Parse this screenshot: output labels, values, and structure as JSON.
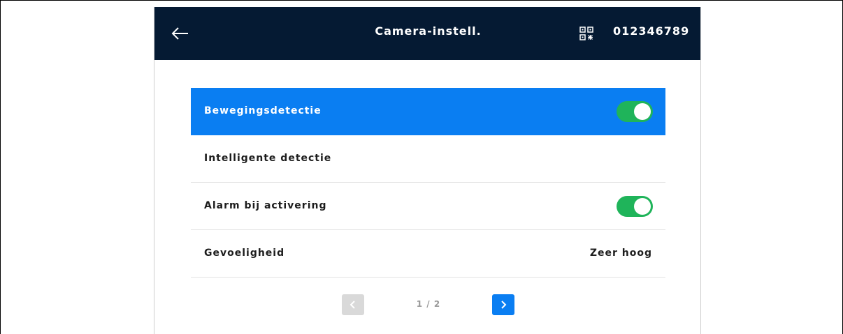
{
  "header": {
    "title": "Camera-instell.",
    "device_id": "012346789",
    "back_icon": "arrow-left-icon",
    "qr_icon": "qr-code-icon"
  },
  "settings": {
    "items": [
      {
        "label": "Bewegingsdetectie",
        "selected": true,
        "toggle": true,
        "toggle_on": true
      },
      {
        "label": "Intelligente detectie",
        "selected": false,
        "toggle": false
      },
      {
        "label": "Alarm bij activering",
        "selected": false,
        "toggle": true,
        "toggle_on": true
      },
      {
        "label": "Gevoeligheid",
        "selected": false,
        "value": "Zeer hoog"
      }
    ]
  },
  "pager": {
    "text": "1 / 2",
    "current": 1,
    "total": 2,
    "prev_icon": "chevron-left-icon",
    "next_icon": "chevron-right-icon"
  },
  "colors": {
    "header_bg": "#051a33",
    "accent": "#0a7ef2",
    "toggle_on": "#1fb45a",
    "disabled": "#d9d9d9"
  }
}
